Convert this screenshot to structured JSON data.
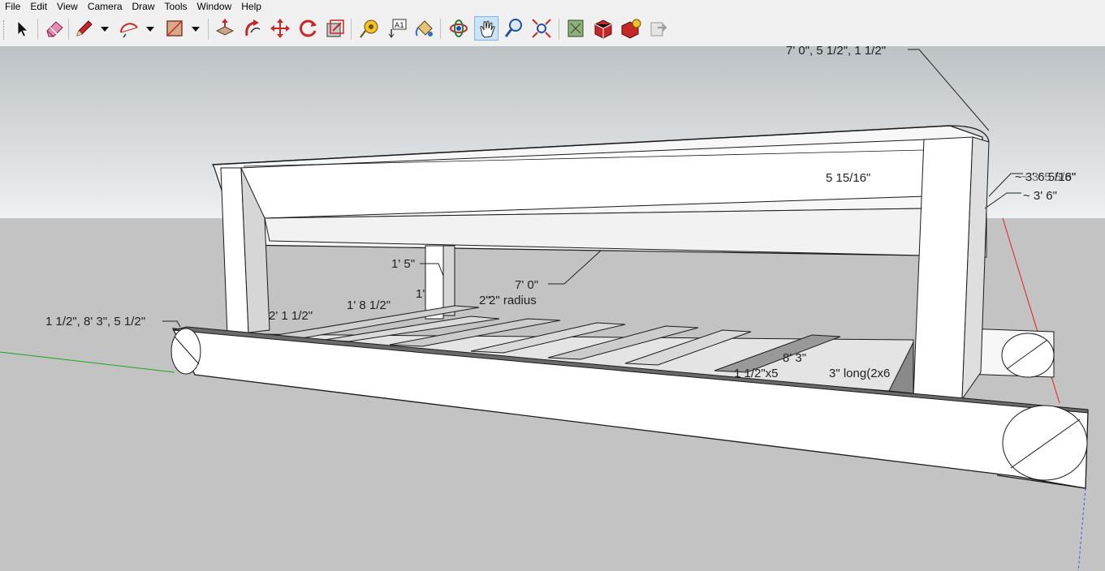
{
  "menu": {
    "file": "File",
    "edit": "Edit",
    "view": "View",
    "camera": "Camera",
    "draw": "Draw",
    "tools": "Tools",
    "window": "Window",
    "help": "Help"
  },
  "toolbar": {
    "tools": [
      "select-icon",
      "eraser-icon",
      "pencil-icon",
      "arc-icon",
      "rectangle-icon",
      "push-pull-icon",
      "follow-me-icon",
      "move-icon",
      "rotate-icon",
      "scale-icon",
      "tape-measure-icon",
      "text-icon",
      "paint-bucket-icon",
      "orbit-icon",
      "pan-icon",
      "zoom-icon",
      "zoom-extents-icon",
      "model-info-icon",
      "3d-warehouse-icon",
      "extension-warehouse-icon",
      "send-to-layout-icon"
    ],
    "active_tool": "pan-icon"
  },
  "dimensions": {
    "top_right": "7' 0\", 5 1/2\", 1 1/2\"",
    "overlap_a": "~ 3' 6 5/16\"",
    "overlap_b": "~ 3' 5 5/8\"",
    "height": "~ 3' 6\"",
    "back_width": "5 15/16\"",
    "post_height": "1' 5\"",
    "length": "7' 0\"",
    "small_one": "1'",
    "radius": "2\" radius",
    "two_inch": "2\"",
    "mid": "1' 8 1/2\"",
    "span": "2' 1 1/2\"",
    "left_beam": "1 1/2\", 8' 3\", 5 1/2\"",
    "slat_a": "8' 3\"",
    "slat_b": "1 1/2\"x5",
    "slat_c": "3\" long(2x6"
  },
  "colors": {
    "sky_top": "#bcc2c6",
    "sky_bottom": "#eef0f1",
    "ground": "#c3c3c3",
    "wood_face": "#ffffff",
    "wood_shade": "#d4d4d4",
    "edge": "#1a1a1a",
    "active_tool_bg": "#cde4f7"
  }
}
